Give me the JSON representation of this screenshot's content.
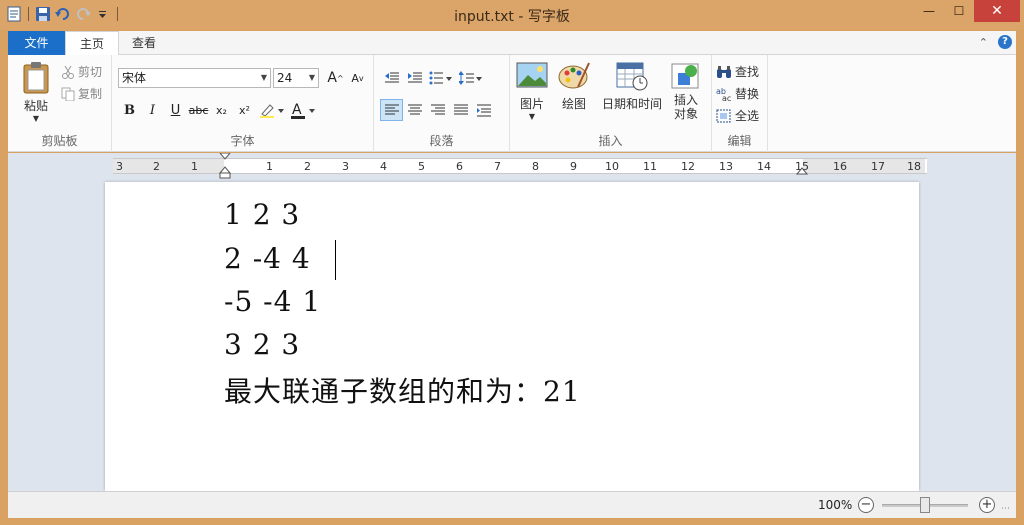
{
  "window": {
    "title": "input.txt - 写字板",
    "minimize_glyph": "—",
    "maximize_glyph": "☐",
    "close_glyph": "✕"
  },
  "qat": {
    "icons": [
      "wordpad-icon",
      "save-icon",
      "undo-icon",
      "redo-icon",
      "customize-icon"
    ]
  },
  "tabs": {
    "file": "文件",
    "home": "主页",
    "view": "查看"
  },
  "ribbon": {
    "clipboard": {
      "label": "剪贴板",
      "paste": "粘贴",
      "cut": "剪切",
      "copy": "复制"
    },
    "font": {
      "label": "字体",
      "family": "宋体",
      "size": "24",
      "bold": "B",
      "italic": "I",
      "underline": "U",
      "strike": "abc",
      "subscript": "x₂",
      "superscript": "x²",
      "grow": "A",
      "shrink": "A"
    },
    "paragraph": {
      "label": "段落"
    },
    "insert": {
      "label": "插入",
      "picture": "图片",
      "paint": "绘图",
      "datetime": "日期和时间",
      "object_line1": "插入",
      "object_line2": "对象"
    },
    "edit": {
      "label": "编辑",
      "find": "查找",
      "replace": "替换",
      "select_all": "全选"
    }
  },
  "ruler": {
    "ticks": [
      "3",
      "2",
      "1",
      "1",
      "2",
      "3",
      "4",
      "5",
      "6",
      "7",
      "8",
      "9",
      "10",
      "11",
      "12",
      "13",
      "14",
      "15",
      "16",
      "17",
      "18"
    ]
  },
  "document": {
    "lines": [
      "1 2 3",
      "2 -4 4",
      "-5 -4 1",
      "3 2 3",
      "最大联通子数组的和为：21"
    ]
  },
  "status": {
    "zoom": "100%",
    "zoom_out": "−",
    "zoom_in": "+"
  },
  "colors": {
    "frame": "#d9a262",
    "file_tab": "#1c6fc9",
    "close_button": "#c7423a"
  }
}
